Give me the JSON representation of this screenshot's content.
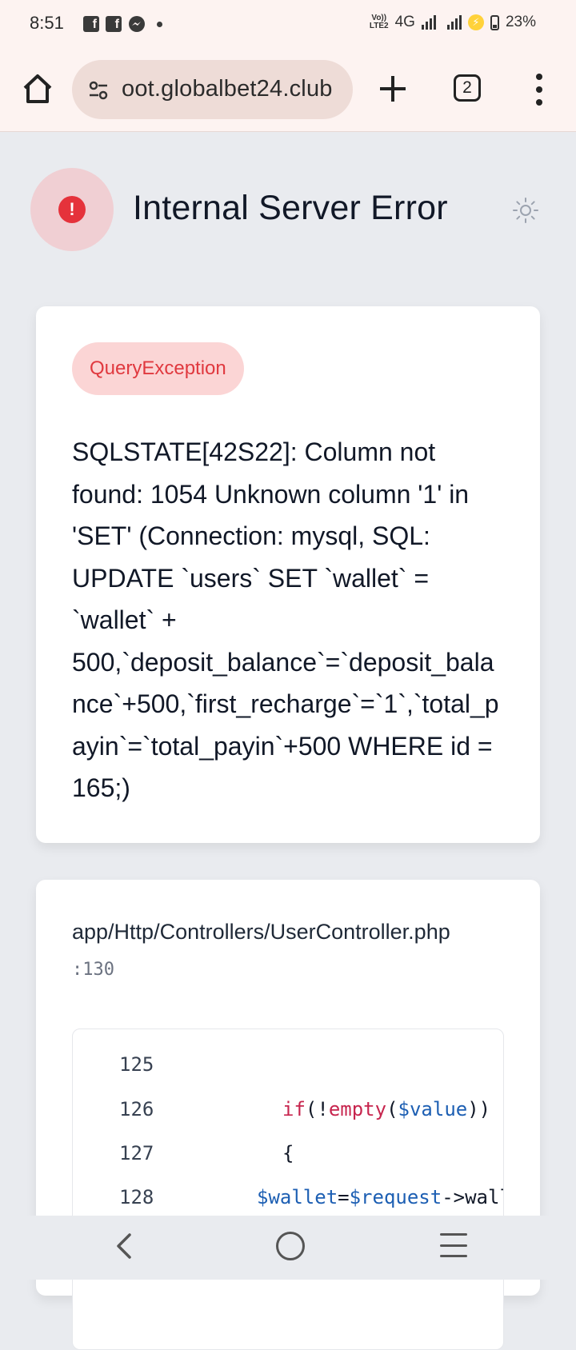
{
  "status_bar": {
    "time": "8:51",
    "network": "4G",
    "volte": "VoLTE2",
    "battery": "23%"
  },
  "browser": {
    "url": "oot.globalbet24.club",
    "tab_count": "2"
  },
  "error": {
    "title": "Internal Server Error",
    "exception_type": "QueryException",
    "message": "SQLSTATE[42S22]: Column not found: 1054 Unknown column '1' in 'SET' (Connection: mysql, SQL: UPDATE `users` SET `wallet` = `wallet` + 500,`deposit_balance`=`deposit_balance`+500,`first_recharge`=`1`,`total_payin`=`total_payin`+500 WHERE id = 165;)"
  },
  "stack": {
    "file": "app/Http/Controllers/UserController.php",
    "line": ":130",
    "code_lines": [
      {
        "num": "125",
        "text": ""
      },
      {
        "num": "126",
        "text": "if(!empty($value))"
      },
      {
        "num": "127",
        "text": "{"
      },
      {
        "num": "128",
        "text": "$wallet=$request->wallet"
      }
    ]
  },
  "colors": {
    "accent_error": "#e5323b",
    "badge_bg": "#fbd5d5",
    "background": "#e9ebef"
  }
}
